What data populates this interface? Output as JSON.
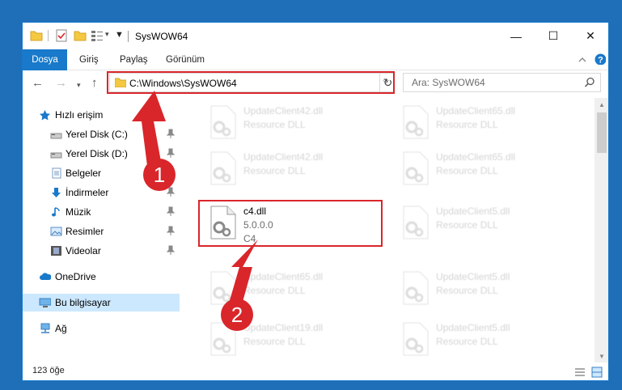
{
  "window": {
    "title": "SysWOW64",
    "controls": {
      "minimize": "—",
      "maximize": "☐",
      "close": "✕"
    }
  },
  "ribbon": {
    "tabs": [
      {
        "label": "Dosya",
        "active": true
      },
      {
        "label": "Giriş"
      },
      {
        "label": "Paylaş"
      },
      {
        "label": "Görünüm"
      }
    ]
  },
  "nav": {
    "address": "C:\\Windows\\SysWOW64",
    "search_placeholder": "Ara: SysWOW64"
  },
  "sidebar": {
    "quick_access": "Hızlı erişim",
    "items": [
      {
        "label": "Yerel Disk (C:)",
        "icon": "drive-icon",
        "pinned": true
      },
      {
        "label": "Yerel Disk (D:)",
        "icon": "drive-icon",
        "pinned": true
      },
      {
        "label": "Belgeler",
        "icon": "documents-icon",
        "pinned": true
      },
      {
        "label": "İndirmeler",
        "icon": "downloads-icon",
        "pinned": true
      },
      {
        "label": "Müzik",
        "icon": "music-icon",
        "pinned": true
      },
      {
        "label": "Resimler",
        "icon": "pictures-icon",
        "pinned": true
      },
      {
        "label": "Videolar",
        "icon": "videos-icon",
        "pinned": true
      }
    ],
    "onedrive": "OneDrive",
    "this_pc": "Bu bilgisayar",
    "network": "Ağ"
  },
  "files": {
    "column1": [
      {
        "name": "UpdateClient42.dll",
        "desc": "Resource DLL"
      },
      {
        "name": "UpdateClient42.dll",
        "desc": "Resource DLL"
      },
      {
        "name": "c4.dll",
        "version": "5.0.0.0",
        "desc": "C4",
        "highlighted": true
      },
      {
        "name": "UpdateClient65.dll",
        "desc": "Resource DLL"
      },
      {
        "name": "UpdateClient19.dll",
        "desc": "Resource DLL"
      }
    ],
    "column2": [
      {
        "name": "UpdateClient65.dll",
        "desc": "Resource DLL"
      },
      {
        "name": "UpdateClient65.dll",
        "desc": "Resource DLL"
      },
      {
        "name": "UpdateClient5.dll",
        "desc": "Resource DLL"
      },
      {
        "name": "UpdateClient5.dll",
        "desc": "Resource DLL"
      },
      {
        "name": "UpdateClient5.dll",
        "desc": "Resource DLL"
      }
    ]
  },
  "status": {
    "item_count": "123 öğe"
  },
  "callouts": {
    "first": "1",
    "second": "2"
  },
  "colors": {
    "accent": "#1979ca",
    "highlight": "#d9262b",
    "selected": "#cce8ff"
  }
}
